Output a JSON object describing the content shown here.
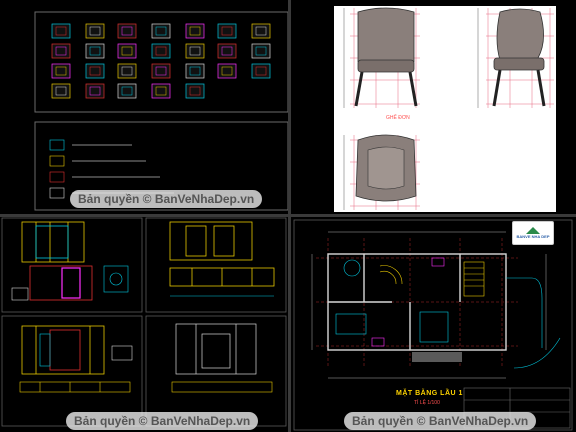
{
  "watermark": {
    "text": "Bản quyền © BanVeNhaDep.vn"
  },
  "plan": {
    "title": "MẶT BẰNG LẦU 1",
    "subtitle": "TỈ LỆ 1/100"
  },
  "chair": {
    "caption": "GHẾ ĐƠN"
  },
  "logo": {
    "text": "BANVE NHA DEP"
  },
  "colors": {
    "background": "#000000",
    "line_cyan": "#00c8e0",
    "line_yellow": "#e8c800",
    "line_red": "#e03030",
    "line_magenta": "#ff30ff",
    "line_white": "#d8d8d8",
    "watermark_bg": "#e6e6e6"
  }
}
